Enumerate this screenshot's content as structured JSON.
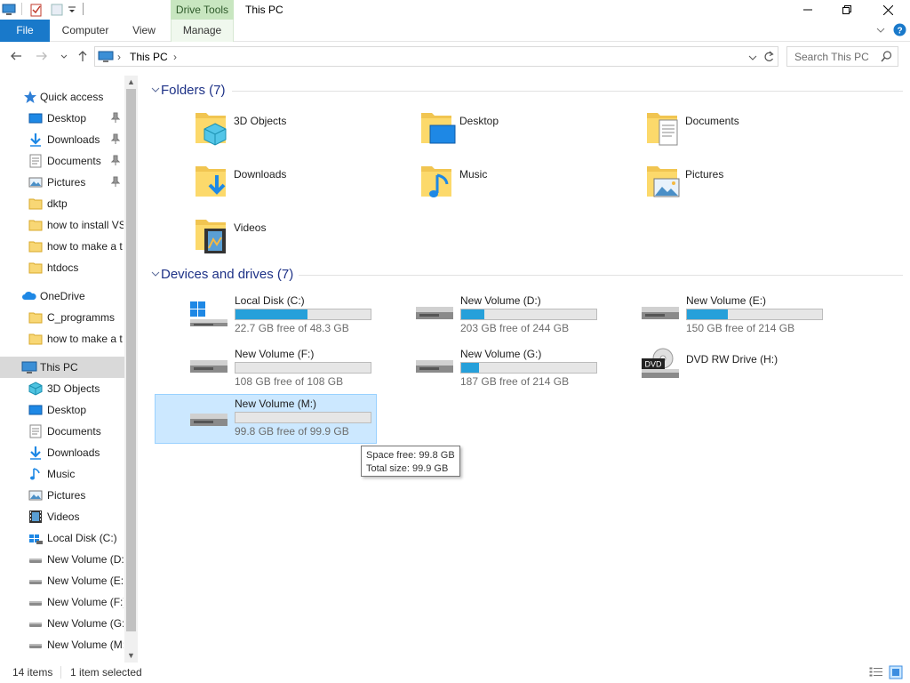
{
  "window": {
    "title": "This PC",
    "context_tab": "Drive Tools"
  },
  "ribbon": {
    "tabs": [
      {
        "label": "File",
        "active": true
      },
      {
        "label": "Computer"
      },
      {
        "label": "View"
      },
      {
        "label": "Manage"
      }
    ]
  },
  "address": {
    "path": [
      "This PC"
    ],
    "search_placeholder": "Search This PC"
  },
  "sidebar": {
    "quick_access": "Quick access",
    "quick_items": [
      {
        "label": "Desktop",
        "icon": "desktop-icon",
        "pinned": true
      },
      {
        "label": "Downloads",
        "icon": "downloads-icon",
        "pinned": true
      },
      {
        "label": "Documents",
        "icon": "documents-icon",
        "pinned": true
      },
      {
        "label": "Pictures",
        "icon": "pictures-icon",
        "pinned": true
      },
      {
        "label": "dktp",
        "icon": "folder-icon"
      },
      {
        "label": "how to install VS",
        "icon": "folder-icon"
      },
      {
        "label": "how to make a t",
        "icon": "folder-icon"
      },
      {
        "label": "htdocs",
        "icon": "folder-icon"
      }
    ],
    "onedrive": "OneDrive",
    "onedrive_items": [
      {
        "label": "C_programms",
        "icon": "folder-icon"
      },
      {
        "label": "how to make a t",
        "icon": "folder-icon"
      }
    ],
    "this_pc": "This PC",
    "pc_items": [
      {
        "label": "3D Objects",
        "icon": "3d-objects-icon"
      },
      {
        "label": "Desktop",
        "icon": "desktop-icon"
      },
      {
        "label": "Documents",
        "icon": "documents-icon"
      },
      {
        "label": "Downloads",
        "icon": "downloads-icon"
      },
      {
        "label": "Music",
        "icon": "music-icon"
      },
      {
        "label": "Pictures",
        "icon": "pictures-icon"
      },
      {
        "label": "Videos",
        "icon": "videos-icon"
      },
      {
        "label": "Local Disk (C:)",
        "icon": "windows-drive-icon"
      },
      {
        "label": "New Volume (D:",
        "icon": "drive-icon"
      },
      {
        "label": "New Volume (E:",
        "icon": "drive-icon"
      },
      {
        "label": "New Volume (F:)",
        "icon": "drive-icon"
      },
      {
        "label": "New Volume (G:",
        "icon": "drive-icon"
      },
      {
        "label": "New Volume (M:",
        "icon": "drive-icon"
      }
    ]
  },
  "folders": {
    "header": "Folders (7)",
    "items": [
      {
        "label": "3D Objects",
        "icon": "3d-objects-icon"
      },
      {
        "label": "Desktop",
        "icon": "desktop-icon"
      },
      {
        "label": "Documents",
        "icon": "documents-icon"
      },
      {
        "label": "Downloads",
        "icon": "downloads-icon"
      },
      {
        "label": "Music",
        "icon": "music-icon"
      },
      {
        "label": "Pictures",
        "icon": "pictures-icon"
      },
      {
        "label": "Videos",
        "icon": "videos-icon"
      }
    ]
  },
  "drives": {
    "header": "Devices and drives (7)",
    "items": [
      {
        "name": "Local Disk (C:)",
        "free": "22.7 GB free of 48.3 GB",
        "used_fraction": 0.53,
        "icon": "windows-drive-icon"
      },
      {
        "name": "New Volume (D:)",
        "free": "203 GB free of 244 GB",
        "used_fraction": 0.17,
        "icon": "drive-icon"
      },
      {
        "name": "New Volume (E:)",
        "free": "150 GB free of 214 GB",
        "used_fraction": 0.3,
        "icon": "drive-icon"
      },
      {
        "name": "New Volume (F:)",
        "free": "108 GB free of 108 GB",
        "used_fraction": 0.0,
        "icon": "drive-icon"
      },
      {
        "name": "New Volume (G:)",
        "free": "187 GB free of 214 GB",
        "used_fraction": 0.13,
        "icon": "drive-icon"
      },
      {
        "name": "DVD RW Drive (H:)",
        "free": "",
        "icon": "dvd-drive-icon"
      },
      {
        "name": "New Volume (M:)",
        "free": "99.8 GB free of 99.9 GB",
        "used_fraction": 0.0,
        "icon": "drive-icon",
        "selected": true
      }
    ]
  },
  "tooltip": {
    "line1": "Space free: 99.8 GB",
    "line2": "Total size: 99.9 GB"
  },
  "status": {
    "items": "14 items",
    "selected": "1 item selected"
  },
  "colors": {
    "accent": "#1979ca",
    "bar_fill": "#26a0da",
    "selection": "#cce8ff",
    "group_header": "#1e3287",
    "drive_tools_tab": "#c8e6c0"
  }
}
